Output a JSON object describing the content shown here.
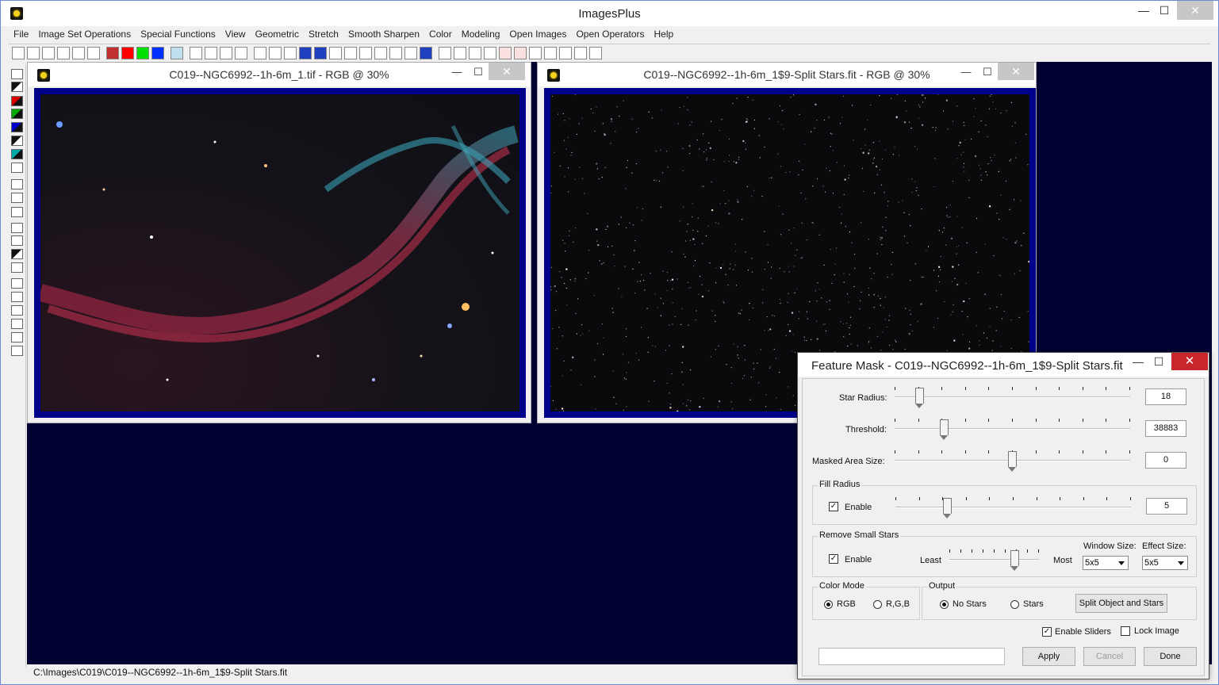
{
  "app": {
    "title": "ImagesPlus",
    "minimize": "—",
    "maximize": "☐",
    "close": "✕"
  },
  "menu": [
    "File",
    "Image Set Operations",
    "Special Functions",
    "View",
    "Geometric",
    "Stretch",
    "Smooth Sharpen",
    "Color",
    "Modeling",
    "Open Images",
    "Open Operators",
    "Help"
  ],
  "windows": {
    "left": {
      "title": "C019--NGC6992--1h-6m_1.tif - RGB @ 30%"
    },
    "right": {
      "title": "C019--NGC6992--1h-6m_1$9-Split Stars.fit - RGB @ 30%"
    }
  },
  "status": {
    "path": "C:\\Images\\C019\\C019--NGC6992--1h-6m_1$9-Split Stars.fit"
  },
  "dialog": {
    "title": "Feature Mask - C019--NGC6992--1h-6m_1$9-Split Stars.fit",
    "star_radius": {
      "label": "Star Radius:",
      "value": "18",
      "level": 0.09
    },
    "threshold": {
      "label": "Threshold:",
      "value": "38883",
      "level": 0.2
    },
    "masked_area": {
      "label": "Masked Area Size:",
      "value": "0",
      "level": 0.5
    },
    "fill_radius": {
      "group": "Fill Radius",
      "enable_label": "Enable",
      "enabled": true,
      "value": "5",
      "level": 0.21
    },
    "remove_small": {
      "group": "Remove Small Stars",
      "enable_label": "Enable",
      "enabled": true,
      "least": "Least",
      "most": "Most",
      "level": 0.75,
      "window_size_label": "Window Size:",
      "window_size": "5x5",
      "effect_size_label": "Effect Size:",
      "effect_size": "5x5"
    },
    "color_mode": {
      "group": "Color Mode",
      "rgb": "RGB",
      "r_g_b": "R,G,B",
      "selected": "RGB"
    },
    "output": {
      "group": "Output",
      "no_stars": "No Stars",
      "stars": "Stars",
      "selected": "No Stars",
      "split_button": "Split Object and Stars"
    },
    "enable_sliders": {
      "label": "Enable Sliders",
      "checked": true
    },
    "lock_image": {
      "label": "Lock Image",
      "checked": false
    },
    "buttons": {
      "apply": "Apply",
      "cancel": "Cancel",
      "done": "Done"
    }
  },
  "colors": {
    "workspace": "#000033",
    "frame": "#00008b",
    "close_red": "#c9262b"
  }
}
